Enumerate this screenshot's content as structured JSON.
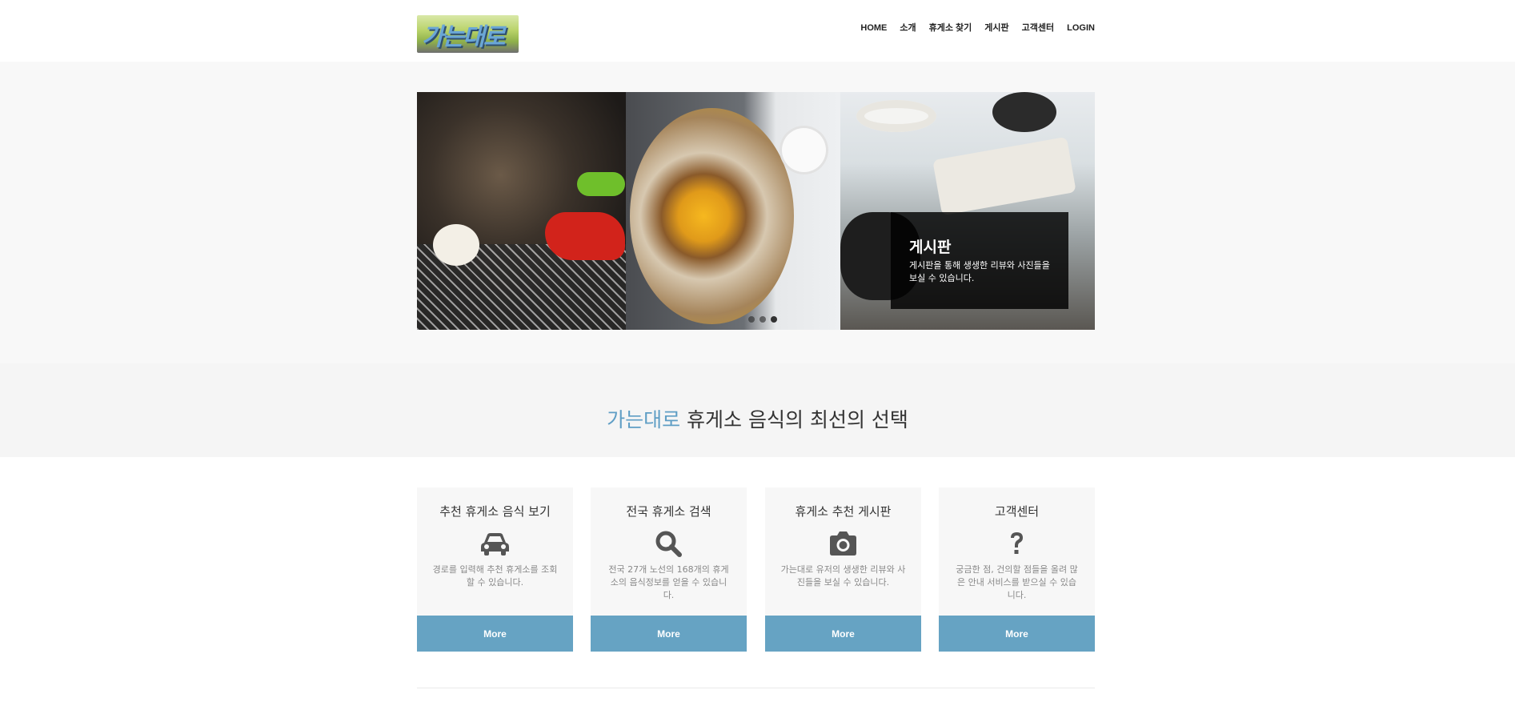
{
  "logo": {
    "text": "가는대로"
  },
  "nav": {
    "items": [
      "HOME",
      "소개",
      "휴게소 찾기",
      "게시판",
      "고객센터",
      "LOGIN"
    ]
  },
  "slider": {
    "caption_title": "게시판",
    "caption_text": "게시판을 통해 생생한 리뷰와 사진들을 보실 수 있습니다.",
    "slide_count": 3,
    "active_slide": 3
  },
  "tagline": {
    "accent": "가는대로",
    "rest": " 휴게소 음식의 최선의 선택"
  },
  "cards": [
    {
      "title": "추천 휴게소 음식 보기",
      "icon": "car-icon",
      "desc": "경로를 입력해 추천 휴게소를 조회 할 수 있습니다.",
      "button": "More"
    },
    {
      "title": "전국 휴게소 검색",
      "icon": "search-icon",
      "desc": "전국 27개 노선의 168개의 휴게소의 음식정보를 얻을 수 있습니다.",
      "button": "More"
    },
    {
      "title": "휴게소 추천 게시판",
      "icon": "camera-icon",
      "desc": "가는대로 유저의 생생한 리뷰와 사진들을 보실 수 있습니다.",
      "button": "More"
    },
    {
      "title": "고객센터",
      "icon": "question-icon",
      "desc": "궁금한 점, 건의할 점들을 올려 많은 안내 서비스를 받으실 수 있습니다.",
      "button": "More"
    }
  ],
  "colors": {
    "accent": "#5f9ec5",
    "button": "#66a3c3",
    "band": "#f5f5f5"
  }
}
